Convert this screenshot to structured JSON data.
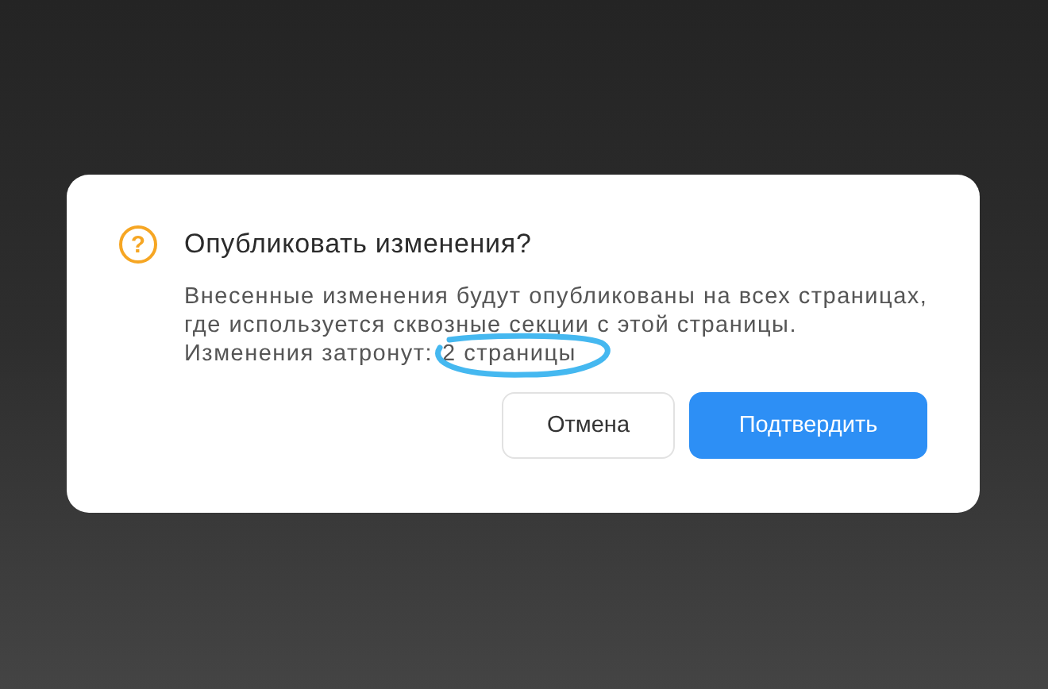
{
  "dialog": {
    "icon": "?",
    "title": "Опубликовать изменения?",
    "message": [
      "Внесенные изменения будут опубликованы на всех страницах,",
      "где используется сквозные секции с этой страницы."
    ],
    "affected": {
      "label": "Изменения затронут:",
      "value": "2 страницы"
    },
    "buttons": [
      {
        "label": "Отмена",
        "kind": "secondary"
      },
      {
        "label": "Подтвердить",
        "kind": "primary"
      }
    ]
  }
}
